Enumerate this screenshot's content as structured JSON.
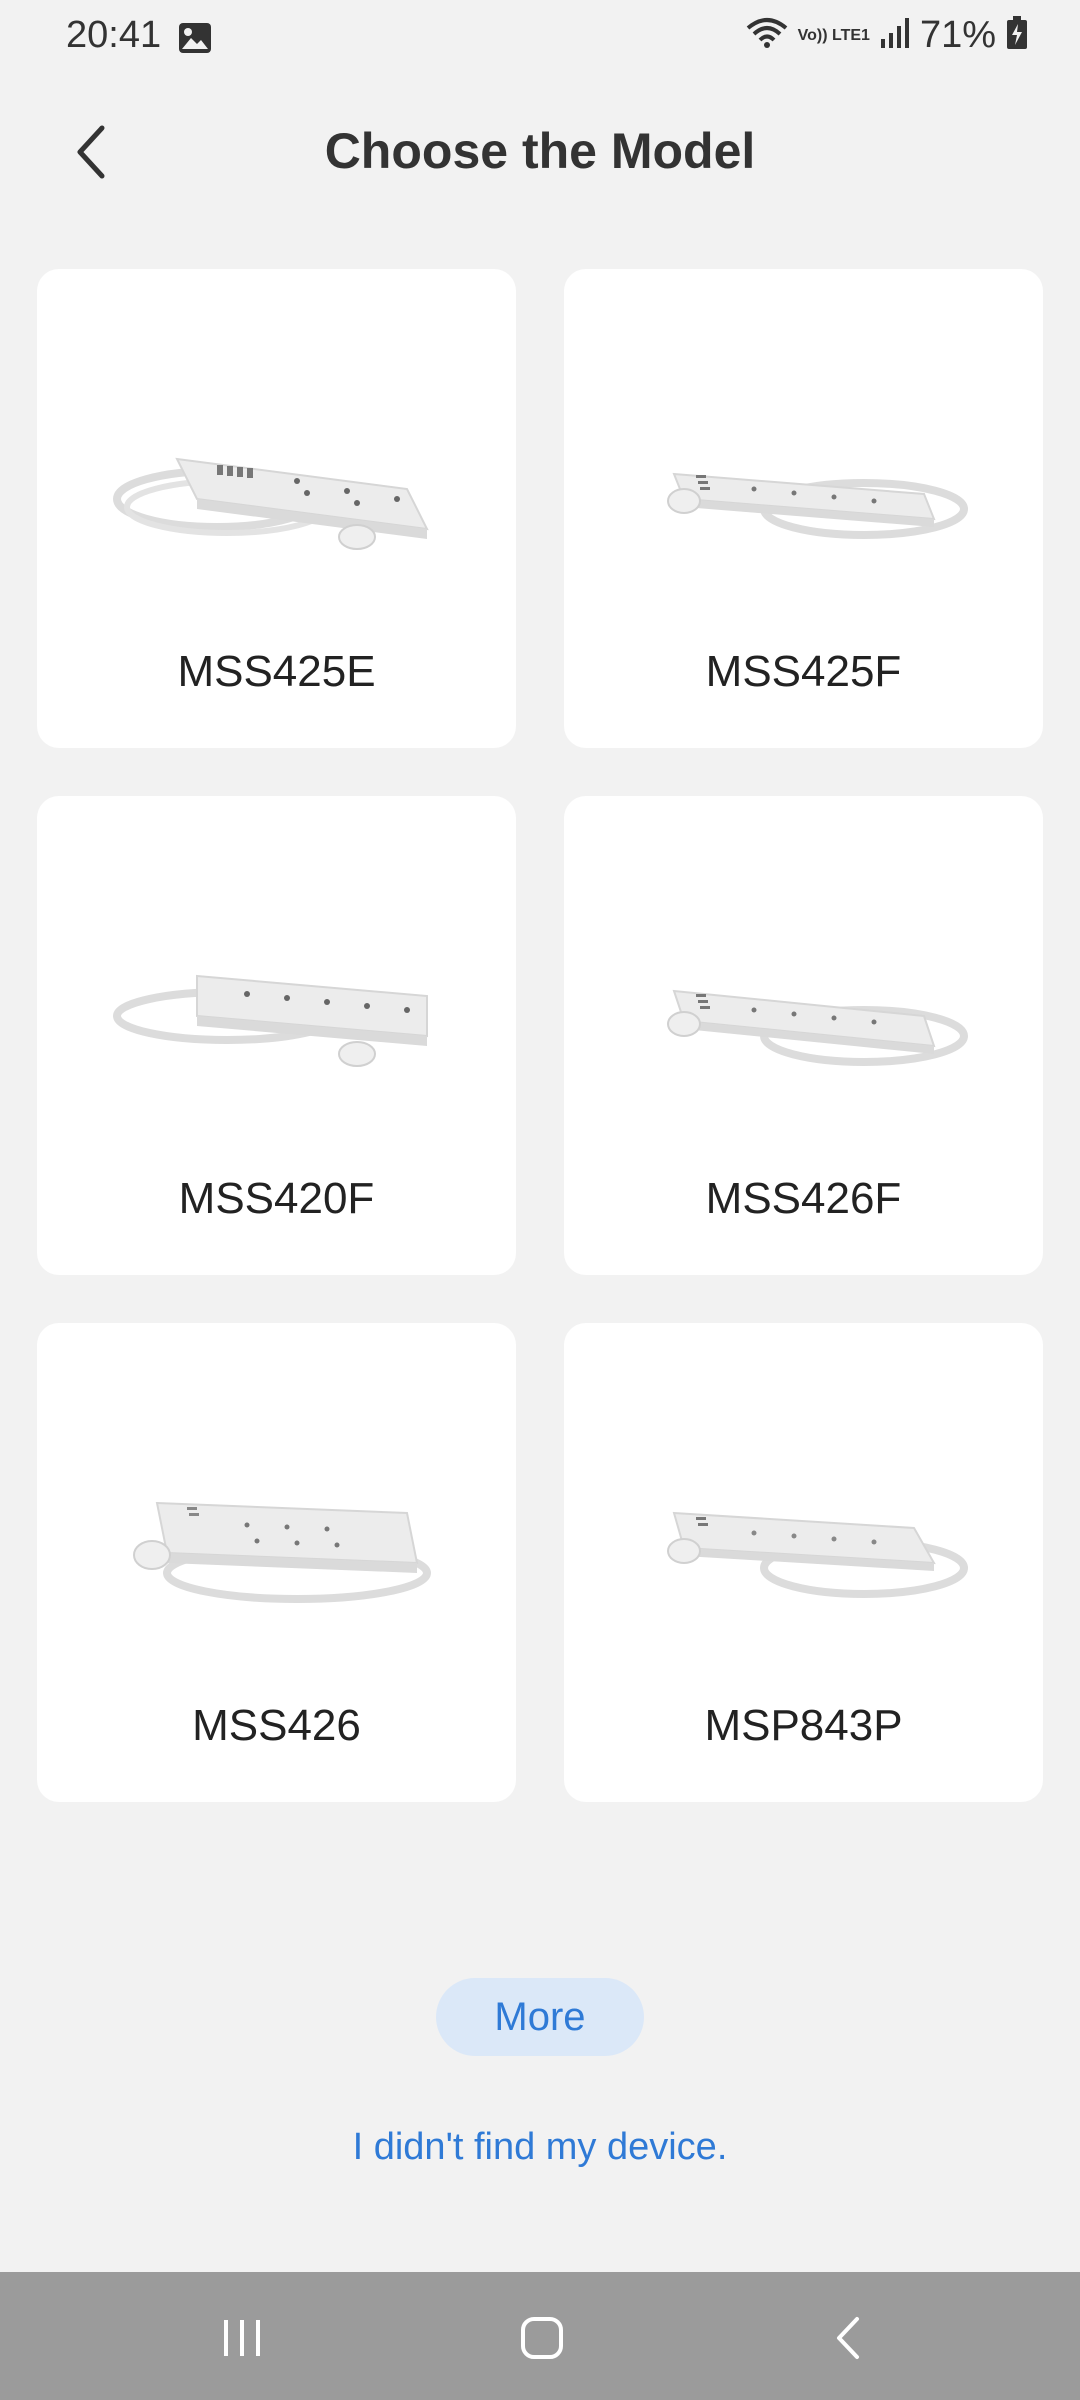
{
  "status_bar": {
    "time": "20:41",
    "network_label": "Vo)) LTE1",
    "battery_percent": "71%"
  },
  "header": {
    "title": "Choose the Model"
  },
  "models": [
    {
      "name": "MSS425E"
    },
    {
      "name": "MSS425F"
    },
    {
      "name": "MSS420F"
    },
    {
      "name": "MSS426F"
    },
    {
      "name": "MSS426"
    },
    {
      "name": "MSP843P"
    }
  ],
  "actions": {
    "more_label": "More",
    "not_found_label": "I didn't find my device."
  },
  "colors": {
    "background": "#f2f2f2",
    "card": "#ffffff",
    "accent": "#2f7ad6",
    "more_button_bg": "#dbe8f8",
    "navbar": "#9b9b9b"
  },
  "icons": {
    "back": "chevron-left-icon",
    "recents": "recents-icon",
    "home": "home-icon",
    "system_back": "system-back-icon"
  }
}
